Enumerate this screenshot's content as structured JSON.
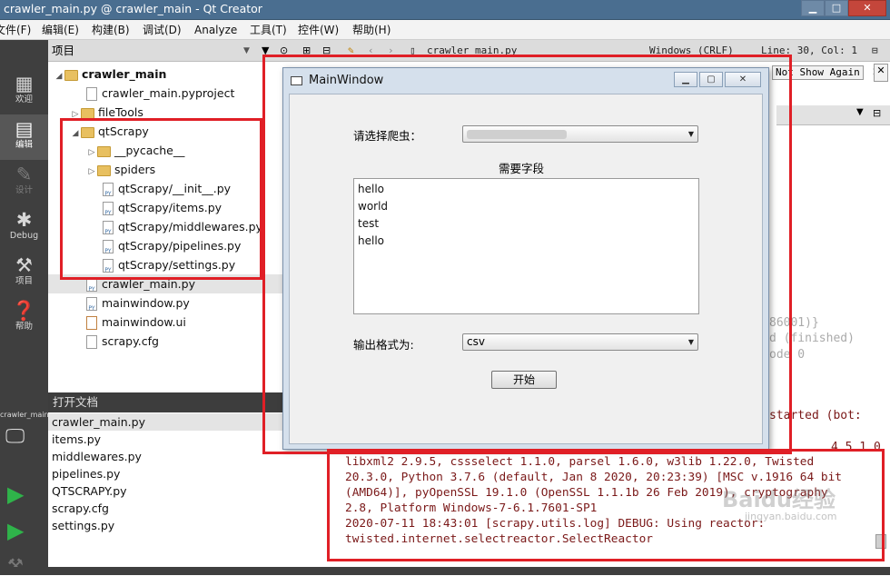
{
  "window": {
    "title": "crawler_main.py @ crawler_main - Qt Creator"
  },
  "menu": [
    "文件(F)",
    "编辑(E)",
    "构建(B)",
    "调试(D)",
    "Analyze",
    "工具(T)",
    "控件(W)",
    "帮助(H)"
  ],
  "modes": [
    {
      "label": "欢迎",
      "icon": "grid-icon"
    },
    {
      "label": "编辑",
      "icon": "edit-icon"
    },
    {
      "label": "设计",
      "icon": "pencil-icon"
    },
    {
      "label": "Debug",
      "icon": "bug-icon"
    },
    {
      "label": "项目",
      "icon": "wrench-icon"
    },
    {
      "label": "帮助",
      "icon": "help-icon"
    }
  ],
  "kit": {
    "label": "crawler_main"
  },
  "project_panel": {
    "title": "项目",
    "tree": [
      {
        "label": "crawler_main",
        "kind": "folder",
        "depth": 0,
        "expanded": true,
        "bold": true
      },
      {
        "label": "crawler_main.pyproject",
        "kind": "file",
        "depth": 1
      },
      {
        "label": "fileTools",
        "kind": "folder",
        "depth": 1,
        "expanded": false
      },
      {
        "label": "qtScrapy",
        "kind": "folder",
        "depth": 1,
        "expanded": true
      },
      {
        "label": "__pycache__",
        "kind": "folder",
        "depth": 2,
        "expanded": false
      },
      {
        "label": "spiders",
        "kind": "folder",
        "depth": 2,
        "expanded": false
      },
      {
        "label": "qtScrapy/__init__.py",
        "kind": "py",
        "depth": 2
      },
      {
        "label": "qtScrapy/items.py",
        "kind": "py",
        "depth": 2
      },
      {
        "label": "qtScrapy/middlewares.py",
        "kind": "py",
        "depth": 2
      },
      {
        "label": "qtScrapy/pipelines.py",
        "kind": "py",
        "depth": 2
      },
      {
        "label": "qtScrapy/settings.py",
        "kind": "py",
        "depth": 2
      },
      {
        "label": "crawler_main.py",
        "kind": "py",
        "depth": 1
      },
      {
        "label": "mainwindow.py",
        "kind": "py",
        "depth": 1
      },
      {
        "label": "mainwindow.ui",
        "kind": "ui",
        "depth": 1
      },
      {
        "label": "scrapy.cfg",
        "kind": "file",
        "depth": 1
      }
    ]
  },
  "open_documents": {
    "title": "打开文档",
    "items": [
      "crawler_main.py",
      "items.py",
      "middlewares.py",
      "pipelines.py",
      "QTSCRAPY.py",
      "scrapy.cfg",
      "settings.py"
    ]
  },
  "editor": {
    "file": "crawler_main.py",
    "encoding": "Windows (CRLF)",
    "position": "Line: 30, Col: 1",
    "banner_button": "Not Show Again",
    "bg_fragments": [
      "86001)}",
      "d (finished)",
      "ode 0",
      "started (bot:",
      "4.5.1.0"
    ]
  },
  "dialog": {
    "title": "MainWindow",
    "label1": "请选择爬虫：",
    "label2": "需要字段",
    "list_items": [
      "hello",
      "world",
      "test",
      "hello"
    ],
    "label3": "输出格式为:",
    "combo2_value": "csv",
    "button_label": "开始"
  },
  "output": {
    "lines": [
      "libxml2 2.9.5, cssselect 1.1.0, parsel 1.6.0, w3lib 1.22.0, Twisted",
      "20.3.0, Python 3.7.6 (default, Jan  8 2020, 20:23:39) [MSC v.1916 64 bit",
      "(AMD64)], pyOpenSSL 19.1.0 (OpenSSL 1.1.1b  26 Feb 2019), cryptography",
      "2.8, Platform Windows-7-6.1.7601-SP1",
      "2020-07-11 18:43:01 [scrapy.utils.log] DEBUG: Using reactor:",
      "twisted.internet.selectreactor.SelectReactor"
    ]
  },
  "watermark": {
    "text": "Baidu经验",
    "sub": "jingyan.baidu.com"
  },
  "colors": {
    "annotation_red": "#e01f26",
    "titlebar": "#4a6e90",
    "modebar": "#3f3f3f",
    "output_text": "#7a1818"
  }
}
